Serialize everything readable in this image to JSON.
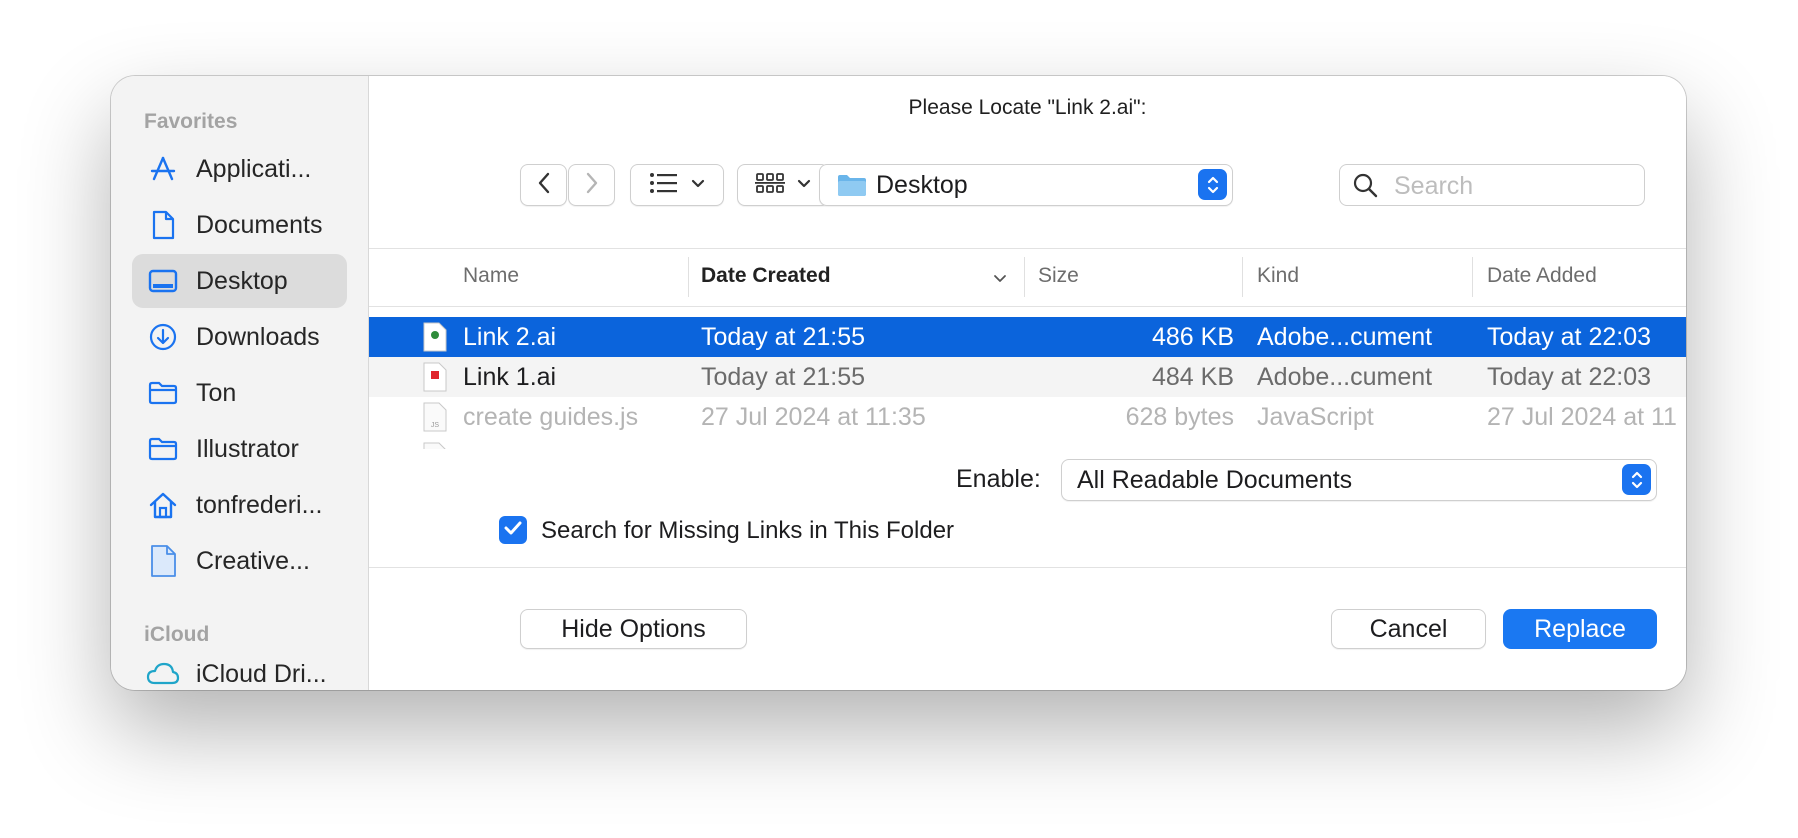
{
  "dialog": {
    "title": "Please Locate \"Link 2.ai\":"
  },
  "sidebar": {
    "favorites_label": "Favorites",
    "icloud_label": "iCloud",
    "items": [
      {
        "label": "Applicati...",
        "icon": "applications-icon"
      },
      {
        "label": "Documents",
        "icon": "document-icon"
      },
      {
        "label": "Desktop",
        "icon": "desktop-icon",
        "selected": true
      },
      {
        "label": "Downloads",
        "icon": "downloads-icon"
      },
      {
        "label": "Ton",
        "icon": "folder-icon"
      },
      {
        "label": "Illustrator",
        "icon": "folder-icon"
      },
      {
        "label": "tonfrederi...",
        "icon": "home-icon"
      },
      {
        "label": "Creative...",
        "icon": "document-icon"
      }
    ],
    "icloud_items": [
      {
        "label": "iCloud Dri...",
        "icon": "cloud-icon"
      }
    ]
  },
  "toolbar": {
    "location": "Desktop",
    "search_placeholder": "Search"
  },
  "list": {
    "columns": {
      "name": "Name",
      "date_created": "Date Created",
      "size": "Size",
      "kind": "Kind",
      "date_added": "Date Added"
    },
    "rows": [
      {
        "name": "Link 2.ai",
        "date_created": "Today at 21:55",
        "size": "486 KB",
        "kind": "Adobe...cument",
        "date_added": "Today at 22:03",
        "selected": true,
        "icon_color": "#2e8b3a"
      },
      {
        "name": "Link 1.ai",
        "date_created": "Today at 21:55",
        "size": "484 KB",
        "kind": "Adobe...cument",
        "date_added": "Today at 22:03",
        "icon_color": "#e0242b"
      },
      {
        "name": "create guides.js",
        "date_created": "27 Jul 2024 at 11:35",
        "size": "628 bytes",
        "kind": "JavaScript",
        "date_added": "27 Jul 2024 at 11",
        "dimmed": true,
        "icon_label": "JS"
      }
    ]
  },
  "options": {
    "enable_label": "Enable:",
    "enable_value": "All Readable Documents",
    "checkbox_label": "Search for Missing Links in This Folder",
    "checkbox_checked": true
  },
  "buttons": {
    "hide_options": "Hide Options",
    "cancel": "Cancel",
    "replace": "Replace"
  },
  "colors": {
    "accent": "#1a78f2",
    "selection": "#0b64dc"
  }
}
